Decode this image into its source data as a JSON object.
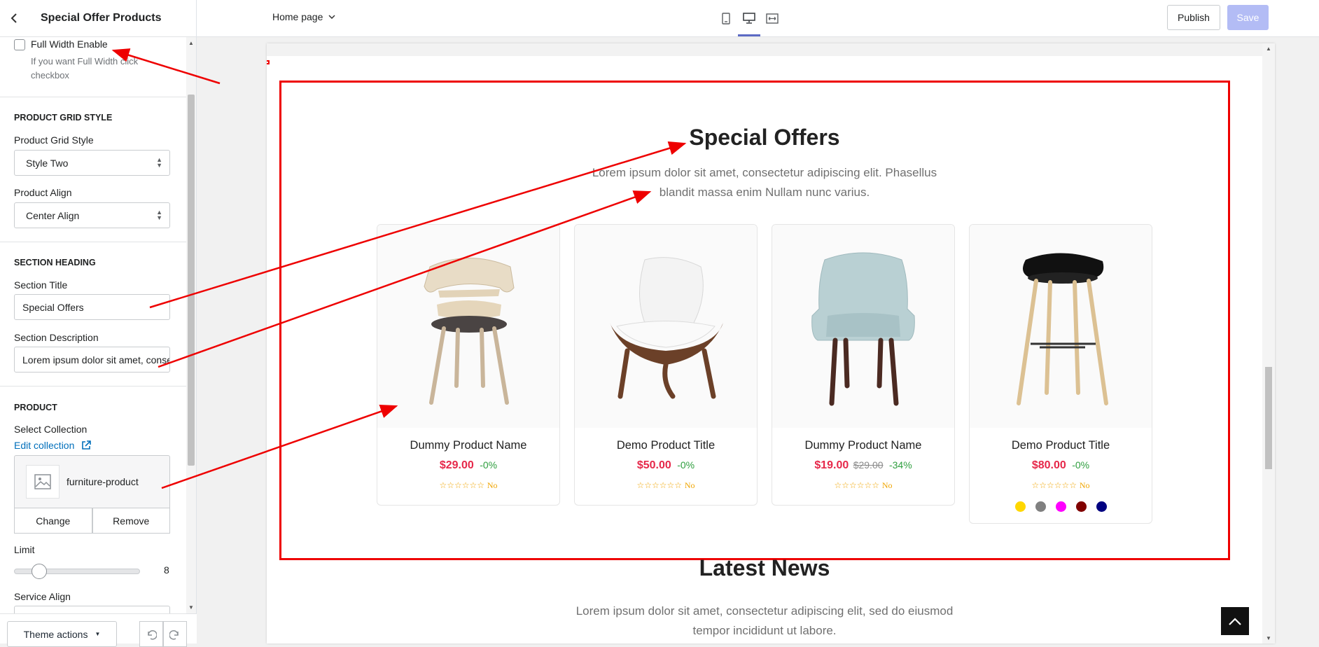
{
  "sidebar": {
    "title": "Special Offer Products",
    "full_width_label": "Full Width Enable",
    "full_width_help": "If you want Full Width click checkbox",
    "grid_section": "PRODUCT GRID STYLE",
    "grid_style_label": "Product Grid Style",
    "grid_style_value": "Style Two",
    "align_label": "Product Align",
    "align_value": "Center Align",
    "heading_section": "SECTION HEADING",
    "title_label": "Section Title",
    "title_value": "Special Offers",
    "desc_label": "Section Description",
    "desc_value": "Lorem ipsum dolor sit amet, consectetur",
    "product_section": "PRODUCT",
    "collection_label": "Select Collection",
    "edit_collection": "Edit collection",
    "collection_name": "furniture-product",
    "change_label": "Change",
    "remove_label": "Remove",
    "limit_label": "Limit",
    "limit_value": "8",
    "service_align_label": "Service Align",
    "theme_actions": "Theme actions"
  },
  "topbar": {
    "page_selector": "Home page",
    "publish": "Publish",
    "save": "Save"
  },
  "preview": {
    "section_title": "Special Offers",
    "section_desc": "Lorem ipsum dolor sit amet, consectetur adipiscing elit. Phasellus blandit massa enim Nullam nunc varius.",
    "products": [
      {
        "name": "Dummy Product Name",
        "price": "$29.00",
        "old_price": "",
        "discount": "-0%",
        "stars": "☆☆☆☆☆☆",
        "reviews": "No"
      },
      {
        "name": "Demo Product Title",
        "price": "$50.00",
        "old_price": "",
        "discount": "-0%",
        "stars": "☆☆☆☆☆☆",
        "reviews": "No"
      },
      {
        "name": "Dummy Product Name",
        "price": "$19.00",
        "old_price": "$29.00",
        "discount": "-34%",
        "stars": "☆☆☆☆☆☆",
        "reviews": "No"
      },
      {
        "name": "Demo Product Title",
        "price": "$80.00",
        "old_price": "",
        "discount": "-0%",
        "stars": "☆☆☆☆☆☆",
        "reviews": "No"
      }
    ],
    "swatch_colors": [
      "#ffd700",
      "#808080",
      "#ff00ff",
      "#800000",
      "#000080"
    ],
    "news_title": "Latest News",
    "news_desc": "Lorem ipsum dolor sit amet, consectetur adipiscing elit, sed do eiusmod tempor incididunt ut labore."
  },
  "colors": {
    "accent": "#5c6ac4",
    "annotation": "#ee0000",
    "price": "#e6284a",
    "discount": "#2e9e3e"
  }
}
